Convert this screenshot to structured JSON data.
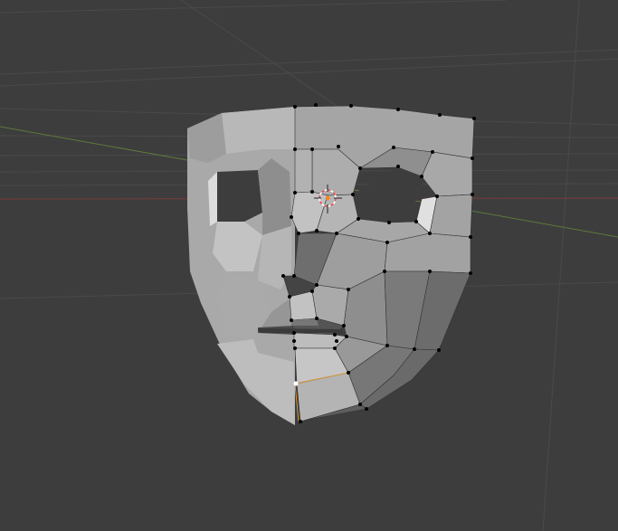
{
  "app": {
    "viewport_label": "",
    "mode": "edit-mode",
    "object": "face-mask-mesh"
  },
  "colors": {
    "background": "#3d3d3d",
    "grid_line": "#4a4a4a",
    "x_axis": "#7a3b3b",
    "y_axis": "#5d7a3b",
    "mesh_light": "#b0b0b0",
    "mesh_shadow": "#5a5a5a",
    "vertex": "#000000",
    "selected_vertex": "#ffffff",
    "selected_edge": "#d89a3a",
    "cursor_ring_red": "#e04a4a",
    "cursor_ring_white": "#ffffff"
  },
  "icons": {
    "cursor": "3d-cursor-icon",
    "active_vertex": "active-vertex-icon"
  }
}
